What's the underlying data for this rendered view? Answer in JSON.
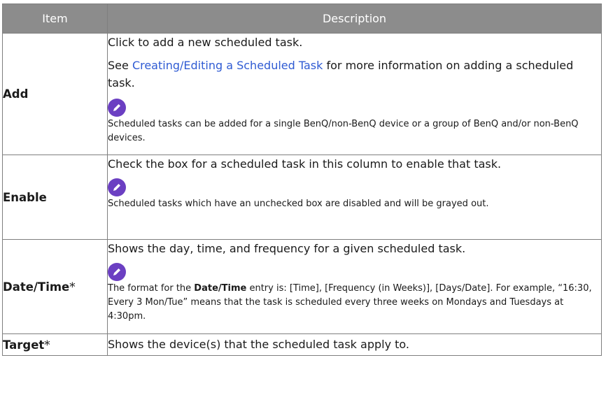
{
  "header": {
    "item": "Item",
    "description": "Description"
  },
  "rows": [
    {
      "item": "Add",
      "line1": "Click to add a new scheduled task.",
      "see_pre": "See ",
      "see_link": "Creating/Editing a Scheduled Task",
      "see_post": " for more information on adding a scheduled task.",
      "note": "Scheduled tasks can be added for a single BenQ/non-BenQ device or a group of BenQ and/or non-BenQ devices."
    },
    {
      "item": "Enable",
      "line1": "Check the box for a scheduled task in this column to enable that task.",
      "note": "Scheduled tasks which have an unchecked box are disabled and will be grayed out."
    },
    {
      "item": "Date/Time",
      "item_star": "*",
      "line1": "Shows the day, time, and frequency for a given scheduled task.",
      "note_pre": "The format for the ",
      "note_bold": "Date/Time",
      "note_post": " entry is: [Time], [Frequency (in Weeks)], [Days/Date]. For example, “16:30, Every 3 Mon/Tue” means that the task is scheduled every three weeks on Mondays and Tuesdays at 4:30pm."
    },
    {
      "item": "Target",
      "item_star": "*",
      "line1": "Shows the device(s) that the scheduled task apply to."
    }
  ],
  "icons": {
    "note": "pencil-icon"
  },
  "colors": {
    "header_bg": "#8c8c8c",
    "link": "#2f5bd3",
    "note_icon": "#6b3fc2"
  }
}
